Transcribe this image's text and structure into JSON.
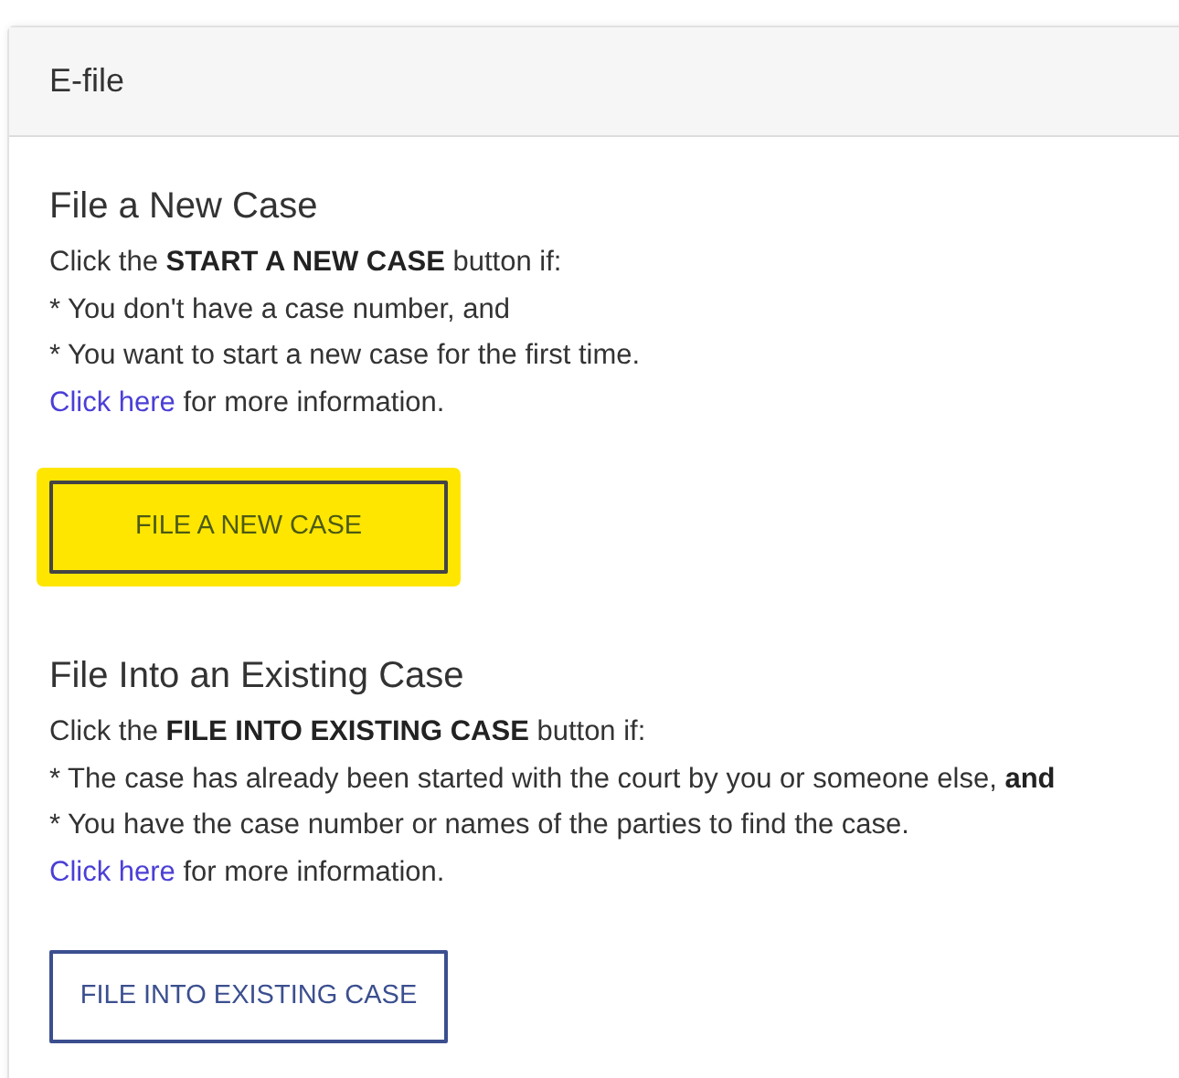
{
  "card": {
    "title": "E-file"
  },
  "sections": [
    {
      "heading": "File a New Case",
      "lines": [
        "Click the **START A NEW CASE** button if:",
        "* You don't have a case number, and",
        "* You want to start a new case for the first time."
      ],
      "link": "Click here",
      "link_rest": " for more information.",
      "button": {
        "label": "FILE A NEW CASE",
        "highlighted": true
      }
    },
    {
      "heading": "File Into an Existing Case",
      "lines": [
        "Click the **FILE INTO EXISTING CASE** button if:",
        "* The case has already been started with the court by you or someone else, **and**",
        "* You have the case number or names of the parties to find the case."
      ],
      "link": "Click here",
      "link_rest": " for more information.",
      "button": {
        "label": "FILE INTO EXISTING CASE",
        "highlighted": false
      }
    }
  ]
}
